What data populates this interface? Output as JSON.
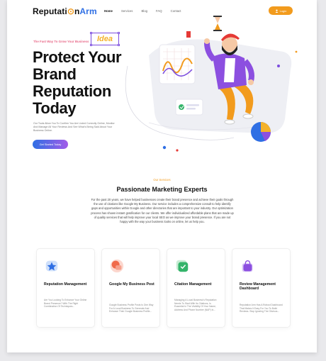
{
  "brand": {
    "name_part1": "Reputati",
    "name_o": "⊙",
    "name_part2": "n",
    "name_part3": "Arm"
  },
  "nav": {
    "items": [
      {
        "label": "Home",
        "active": true
      },
      {
        "label": "Services",
        "active": false
      },
      {
        "label": "Blog",
        "active": false
      },
      {
        "label": "FAQ",
        "active": false
      },
      {
        "label": "Contact",
        "active": false
      }
    ],
    "login_label": "Login"
  },
  "hero": {
    "eyebrow": "The Fast Way To Grow Your Business",
    "badge": "Idea",
    "headline": "Protect Your Brand Reputation Today",
    "description": "Our Tools Allow You To Confirm You Are Listed Correctly Online, Monitor And Manage All Your Reviews And See What's Being Said About Your Business Online.",
    "cta_label": "Get Started Today"
  },
  "services": {
    "eyebrow": "Our Services",
    "title": "Passionate Marketing Experts",
    "description": "For the past 20 years, we have helped businesses create their brand presence and achieve their goals through the use of citations like Google My Business. Our service includes a comprehensive consult to help identify gaps and opportunities within Google and other directories that are important to your industry. Our optimization process has shown instant gratification for our clients. We offer individualized affordable plans that are made up of quality services that will help improve your local SEO as we improve your brand presence. If you are not happy with the way your business looks on online, let us help you.",
    "cards": [
      {
        "title": "Reputation Management",
        "description": "Are You Looking To Enhance Your Online Brand Presence? With The Right Combination Of Techniques...",
        "color": "#2f6fe4"
      },
      {
        "title": "Google My Business Post",
        "description": "Google Business Profile Posts Is One Way For A Local Business To Generate And Enhance Their Google Business Profile...",
        "color": "#f06a4a"
      },
      {
        "title": "Citation Management",
        "description": "Managing A Local Business's Reputation Needs To Start With Its Citations, Is Essential In The Visibility Of Your Name, Address And Phone Number (NAP) In...",
        "color": "#34b46a"
      },
      {
        "title": "Review Management Dashboard",
        "description": "Reputation Arm Has A Robust Dashboard That Makes It Easy For You To Build Reviews. Stop Ignoring The Obvious...",
        "color": "#8c4fe0"
      }
    ]
  }
}
